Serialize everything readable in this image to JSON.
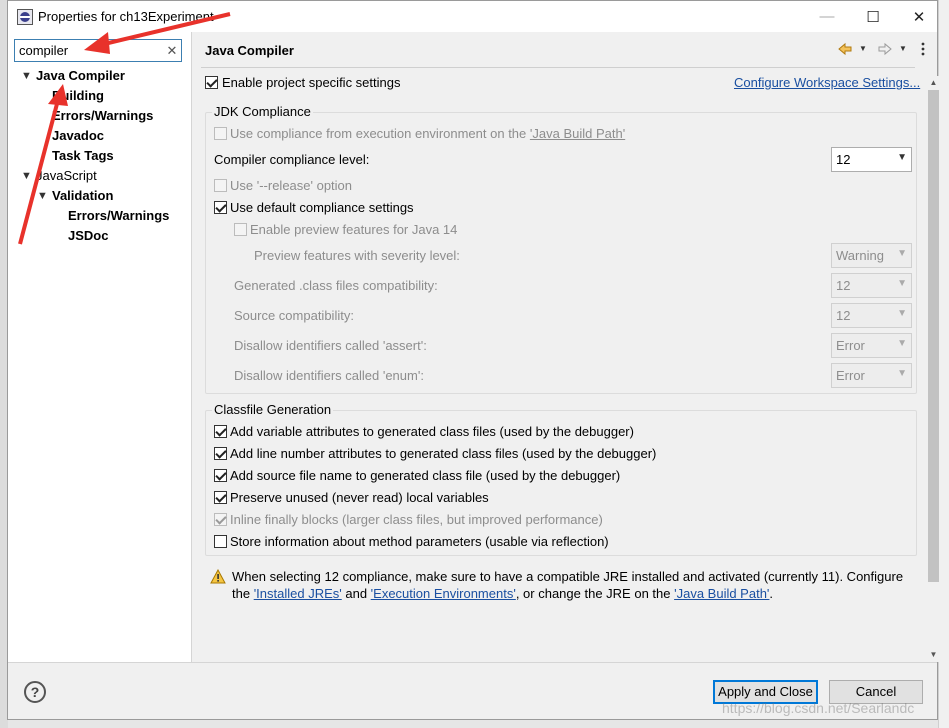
{
  "window": {
    "title": "Properties for ch13Experiment",
    "controls": {
      "minimize": "—",
      "maximize": "☐",
      "close": "✕"
    }
  },
  "sidebar": {
    "filter": {
      "value": "compiler",
      "clear": "✕"
    },
    "tree": [
      {
        "label": "Java Compiler",
        "expanded": true,
        "bold": true
      },
      {
        "label": "Building",
        "bold": true
      },
      {
        "label": "Errors/Warnings",
        "bold": true
      },
      {
        "label": "Javadoc",
        "bold": true
      },
      {
        "label": "Task Tags",
        "bold": true
      },
      {
        "label": "JavaScript",
        "expanded": true,
        "bold": false
      },
      {
        "label": "Validation",
        "expanded": true,
        "bold": true
      },
      {
        "label": "Errors/Warnings",
        "bold": true
      },
      {
        "label": "JSDoc",
        "bold": true
      }
    ]
  },
  "page": {
    "title": "Java Compiler",
    "enable_specific": {
      "label": "Enable project specific settings",
      "checked": true
    },
    "configure_link": "Configure Workspace Settings...",
    "jdk": {
      "title": "JDK Compliance",
      "use_env": {
        "label": "Use compliance from execution environment on the ",
        "link": "'Java Build Path'",
        "checked": false,
        "enabled": false
      },
      "level_label": "Compiler compliance level:",
      "level_value": "12",
      "release": {
        "label": "Use '--release' option",
        "checked": false,
        "enabled": false
      },
      "use_default": {
        "label": "Use default compliance settings",
        "checked": true,
        "enabled": true
      },
      "preview": {
        "label": "Enable preview features for Java 14",
        "checked": false,
        "enabled": false
      },
      "rows": [
        {
          "label": "Preview features with severity level:",
          "value": "Warning"
        },
        {
          "label": "Generated .class files compatibility:",
          "value": "12"
        },
        {
          "label": "Source compatibility:",
          "value": "12"
        },
        {
          "label": "Disallow identifiers called 'assert':",
          "value": "Error"
        },
        {
          "label": "Disallow identifiers called 'enum':",
          "value": "Error"
        }
      ]
    },
    "classfile": {
      "title": "Classfile Generation",
      "options": [
        {
          "label": "Add variable attributes to generated class files (used by the debugger)",
          "checked": true,
          "enabled": true
        },
        {
          "label": "Add line number attributes to generated class files (used by the debugger)",
          "checked": true,
          "enabled": true
        },
        {
          "label": "Add source file name to generated class file (used by the debugger)",
          "checked": true,
          "enabled": true
        },
        {
          "label": "Preserve unused (never read) local variables",
          "checked": true,
          "enabled": true
        },
        {
          "label": "Inline finally blocks (larger class files, but improved performance)",
          "checked": true,
          "enabled": false
        },
        {
          "label": "Store information about method parameters (usable via reflection)",
          "checked": false,
          "enabled": true
        }
      ]
    },
    "warning": {
      "line1": "When selecting 12 compliance, make sure to have a compatible JRE installed and activated (currently 11). Configure",
      "the": "the ",
      "link1": "'Installed JREs'",
      "and": " and ",
      "link2": "'Execution Environments'",
      "mid": ", or change the JRE on the ",
      "link3": "'Java Build Path'",
      "end": "."
    }
  },
  "footer": {
    "help": "?",
    "apply_close": "Apply and Close",
    "cancel": "Cancel"
  },
  "watermark": "https://blog.csdn.net/Searlandc",
  "colors": {
    "link": "#1a4fa0",
    "annotation_arrow": "#e8322b",
    "default_button_border": "#0078d7"
  }
}
